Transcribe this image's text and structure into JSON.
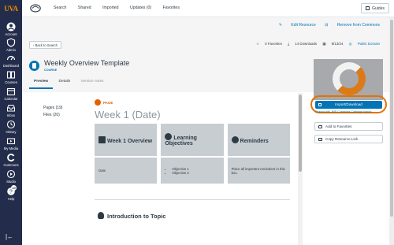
{
  "sidebar": {
    "logo": "UVA",
    "items": [
      {
        "label": "Account",
        "icon": "account-icon"
      },
      {
        "label": "Admin",
        "icon": "admin-icon"
      },
      {
        "label": "Dashboard",
        "icon": "dashboard-icon"
      },
      {
        "label": "Courses",
        "icon": "courses-icon"
      },
      {
        "label": "Calendar",
        "icon": "calendar-icon"
      },
      {
        "label": "Inbox",
        "icon": "inbox-icon"
      },
      {
        "label": "History",
        "icon": "history-icon"
      },
      {
        "label": "My Media",
        "icon": "my-media-icon"
      },
      {
        "label": "Commons",
        "icon": "commons-icon"
      },
      {
        "label": "Studio",
        "icon": "studio-icon"
      },
      {
        "label": "Help",
        "icon": "help-icon",
        "badge": "10"
      }
    ],
    "collapse_icon": "collapse-nav-icon"
  },
  "topbar": {
    "nav": [
      "Search",
      "Shared",
      "Imported",
      "Updates (0)",
      "Favorites"
    ],
    "guides": "Guides"
  },
  "resource": {
    "edit_resource": "Edit Resource",
    "remove_from_commons": "Remove from Commons",
    "back": "Back to Search",
    "favorites": "0 Favorites",
    "downloads": "14 Downloads",
    "date": "8/13/24",
    "license": "Public Domain",
    "title": "Weekly Overview Template",
    "type": "COURSE",
    "tabs": [
      "Preview",
      "Details",
      "Version notes"
    ]
  },
  "content_nav": {
    "pages": "Pages (19)",
    "files": "Files (20)"
  },
  "preview": {
    "page_label": "PAGE",
    "heading": "Week 1 (Date)",
    "table": {
      "headers": [
        "Week 1 Overview",
        "Learning Objectives",
        "Reminders"
      ],
      "row": {
        "date": "Date",
        "objectives": [
          "Objective 1",
          "Objective 2"
        ],
        "reminders": "Place all important reminders in this box."
      }
    },
    "intro_heading": "Introduction to Topic"
  },
  "side_panel": {
    "import_download": "Import/Download",
    "shared_with": "Shared with JMS Commons Cartridge Import",
    "add_to_favorites": "Add to Favorites",
    "copy_link": "Copy Resource Link"
  },
  "colors": {
    "nav_bg": "#232d4b",
    "uva_orange": "#e57200",
    "link_blue": "#0374b5",
    "page_orange": "#e66000"
  }
}
